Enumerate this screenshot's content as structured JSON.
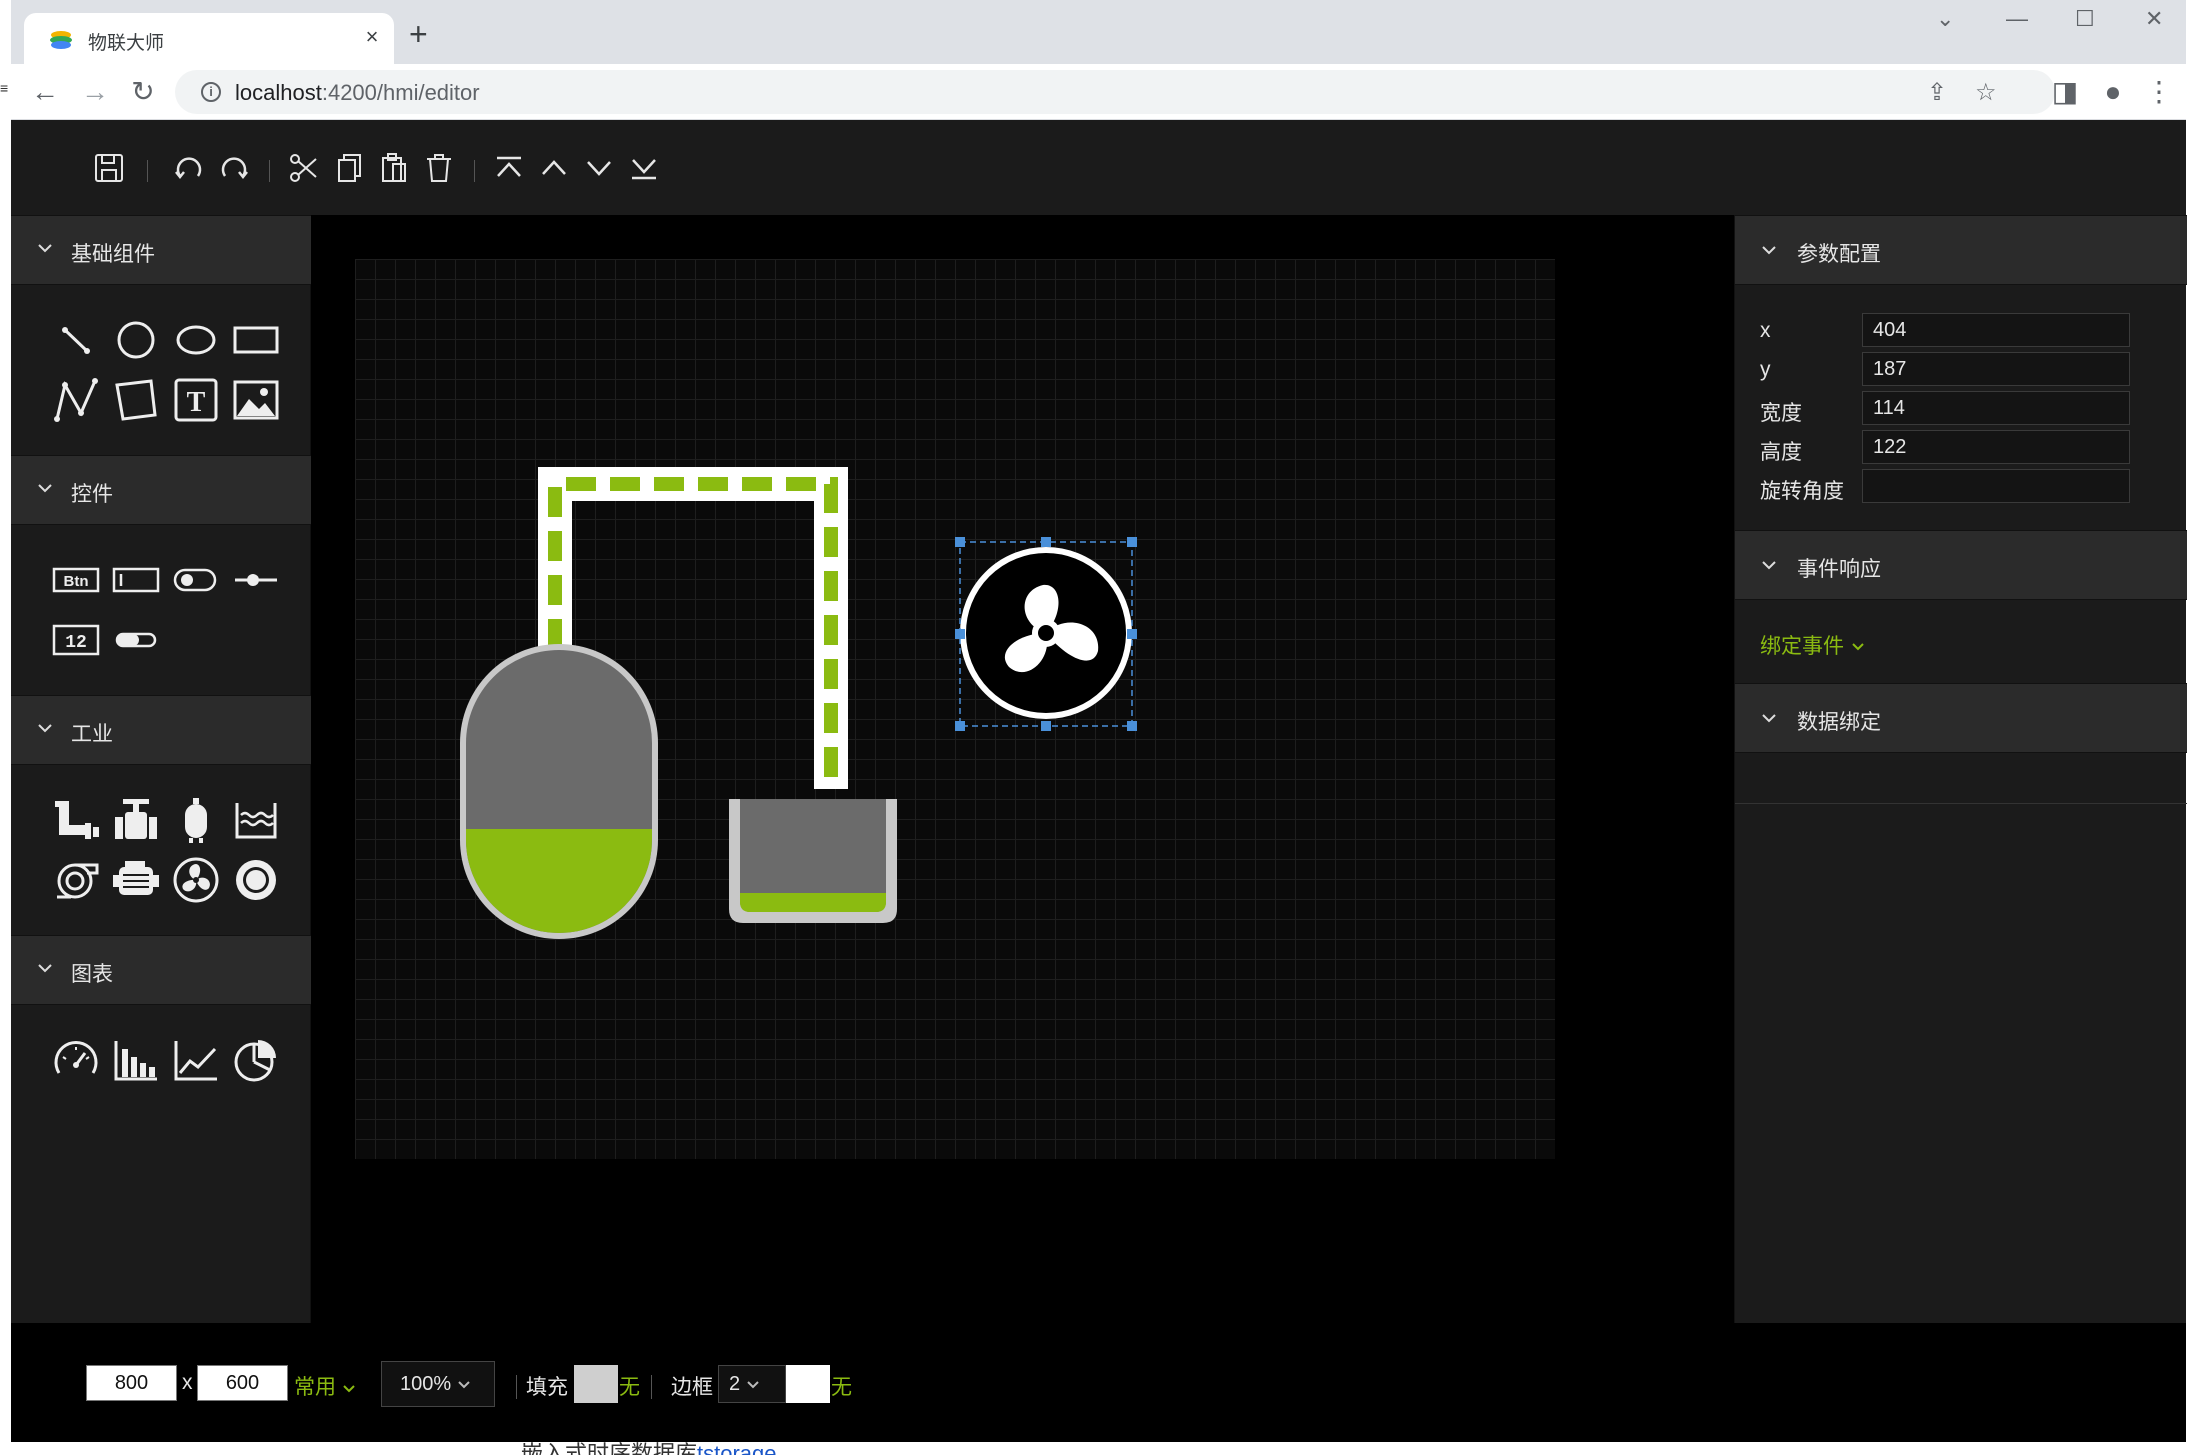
{
  "browser": {
    "tab_title": "物联大师",
    "tab_close": "×",
    "new_tab": "+",
    "url_host": "localhost",
    "url_rest": ":4200/hmi/editor"
  },
  "toolbar": {
    "buttons": [
      "save-icon",
      "undo-icon",
      "redo-icon",
      "cut-icon",
      "copy-icon",
      "paste-icon",
      "delete-icon",
      "bring-to-top-icon",
      "move-up-icon",
      "move-down-icon",
      "send-to-bottom-icon"
    ]
  },
  "left_panel": {
    "sections": [
      {
        "label": "基础组件",
        "icons": [
          "line-icon",
          "circle-icon",
          "ellipse-icon",
          "rectangle-icon",
          "polyline-icon",
          "polygon-icon",
          "text-icon",
          "image-icon"
        ]
      },
      {
        "label": "控件",
        "icons": [
          "button-control-icon",
          "input-control-icon",
          "switch-control-icon",
          "slider-control-icon",
          "number-control-icon",
          "toggle-control-icon"
        ]
      },
      {
        "label": "工业",
        "icons": [
          "pipe-icon",
          "valve-icon",
          "tank-icon",
          "pool-icon",
          "pump-icon",
          "motor-icon",
          "fan-icon",
          "ring-icon"
        ]
      },
      {
        "label": "图表",
        "icons": [
          "gauge-icon",
          "bar-chart-icon",
          "line-chart-icon",
          "pie-chart-icon"
        ]
      }
    ],
    "control_btn_text": "Btn",
    "control_num_text": "12",
    "text_tool_glyph": "T"
  },
  "right_panel": {
    "params_title": "参数配置",
    "params": [
      {
        "label": "x",
        "value": "404"
      },
      {
        "label": "y",
        "value": "187"
      },
      {
        "label": "宽度",
        "value": "114"
      },
      {
        "label": "高度",
        "value": "122"
      },
      {
        "label": "旋转角度",
        "value": ""
      }
    ],
    "events_title": "事件响应",
    "bind_event": "绑定事件",
    "data_title": "数据绑定"
  },
  "bottom_bar": {
    "width": "800",
    "times": "x",
    "height": "600",
    "preset": "常用",
    "zoom": "100%",
    "fill_label": "填充",
    "fill_none": "无",
    "border_label": "边框",
    "border_width": "2",
    "border_none": "无"
  },
  "under_page": {
    "text": "嵌入式时序数据库",
    "link": "tstorage"
  },
  "colors": {
    "accent_green": "#8bbb11",
    "tank_gray": "#6b6b6b",
    "tank_border": "#c8c8c8",
    "selection": "#4a90d9"
  }
}
